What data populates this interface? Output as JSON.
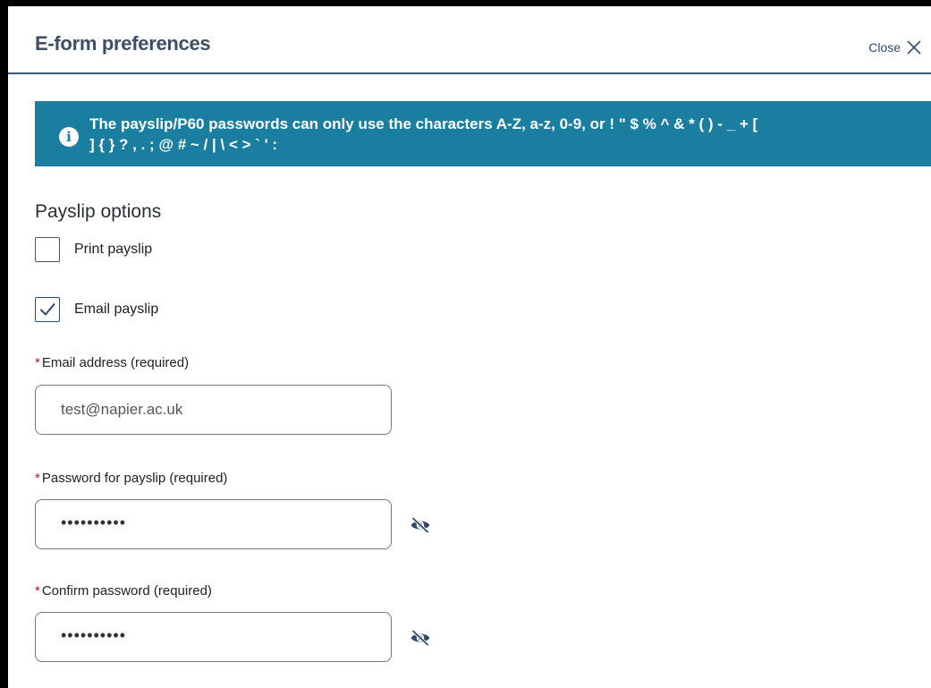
{
  "dialog": {
    "title": "E-form preferences",
    "close_label": "Close"
  },
  "banner": {
    "icon": "info-icon",
    "message": "The payslip/P60 passwords can only use the characters A-Z, a-z, 0-9, or ! \" $ % ^ & * ( ) - _ + [\n] { } ? , . ; @ # ~ / | \\ < > ` ' :"
  },
  "payslip": {
    "section_title": "Payslip options",
    "print_label": "Print payslip",
    "print_checked": false,
    "email_label": "Email payslip",
    "email_checked": true
  },
  "fields": {
    "email": {
      "required_mark": "*",
      "label": "Email address (required)",
      "value": "test@napier.ac.uk"
    },
    "password": {
      "required_mark": "*",
      "label": "Password for payslip (required)",
      "value": "••••••••••"
    },
    "confirm": {
      "required_mark": "*",
      "label": "Confirm password (required)",
      "value": "••••••••••"
    }
  },
  "colors": {
    "banner": "#1a7ea1",
    "accent": "#2f4a6d",
    "required": "#c8102e"
  }
}
